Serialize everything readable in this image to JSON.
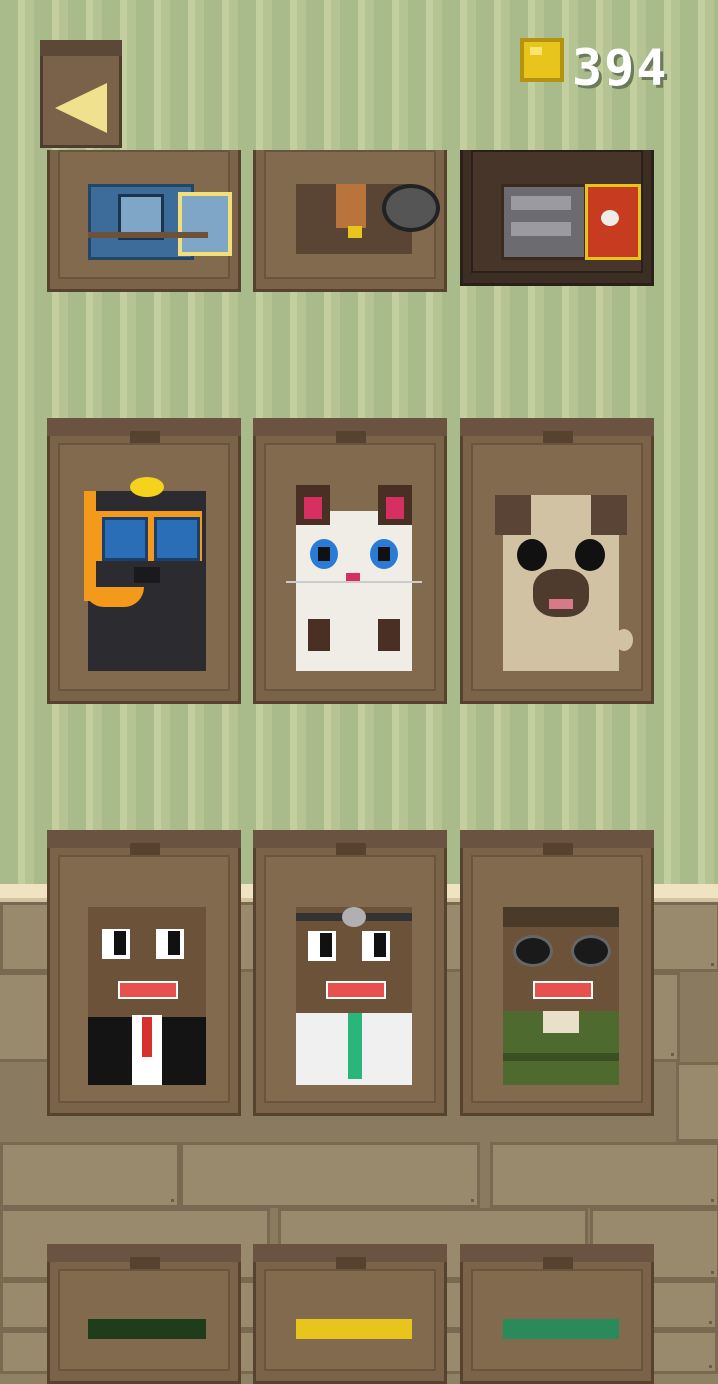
{
  "header": {
    "back_icon": "back-arrow-icon",
    "coin_icon": "coin-icon",
    "coins": "394"
  },
  "characters": [
    {
      "id": "knight",
      "icon": "knight-character-icon",
      "row": 0
    },
    {
      "id": "pirate",
      "icon": "pirate-character-icon",
      "row": 0
    },
    {
      "id": "roman",
      "icon": "roman-character-icon",
      "row": 0,
      "selected": true
    },
    {
      "id": "diver",
      "icon": "diver-character-icon",
      "row": 1
    },
    {
      "id": "cat",
      "icon": "cat-character-icon",
      "row": 1
    },
    {
      "id": "pug",
      "icon": "pug-character-icon",
      "row": 1
    },
    {
      "id": "businessman",
      "icon": "businessman-character-icon",
      "row": 2
    },
    {
      "id": "doctor",
      "icon": "doctor-character-icon",
      "row": 2
    },
    {
      "id": "pilot",
      "icon": "pilot-character-icon",
      "row": 2
    },
    {
      "id": "green-hat",
      "icon": "green-hat-character-icon",
      "row": 3
    },
    {
      "id": "gold-hat",
      "icon": "gold-hat-character-icon",
      "row": 3
    },
    {
      "id": "crown",
      "icon": "crown-character-icon",
      "row": 3
    }
  ],
  "colors": {
    "wall_stripe": "#a9bb8a",
    "card": "#7a6349",
    "coin": "#e8c51c",
    "back_arrow": "#efe18e"
  }
}
